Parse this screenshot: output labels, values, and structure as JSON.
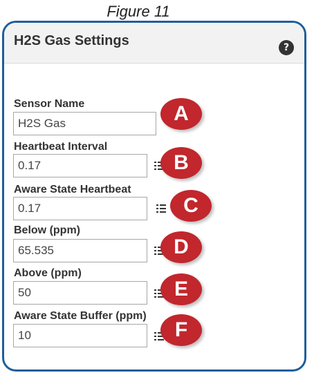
{
  "caption": "Figure 11",
  "panel": {
    "title": "H2S Gas Settings",
    "help_icon": "?"
  },
  "fields": [
    {
      "label": "Sensor Name",
      "value": "H2S Gas",
      "badge": "A"
    },
    {
      "label": "Heartbeat Interval",
      "value": "0.17",
      "badge": "B"
    },
    {
      "label": "Aware State Heartbeat",
      "value": "0.17",
      "badge": "C"
    },
    {
      "label": "Below  (ppm)",
      "value": "65.535",
      "badge": "D"
    },
    {
      "label": "Above  (ppm)",
      "value": "50",
      "badge": "E"
    },
    {
      "label": "Aware State Buffer (ppm)",
      "value": "10",
      "badge": "F"
    }
  ],
  "colors": {
    "frame_border": "#1f5e9b",
    "badge_red": "#c1272d"
  }
}
